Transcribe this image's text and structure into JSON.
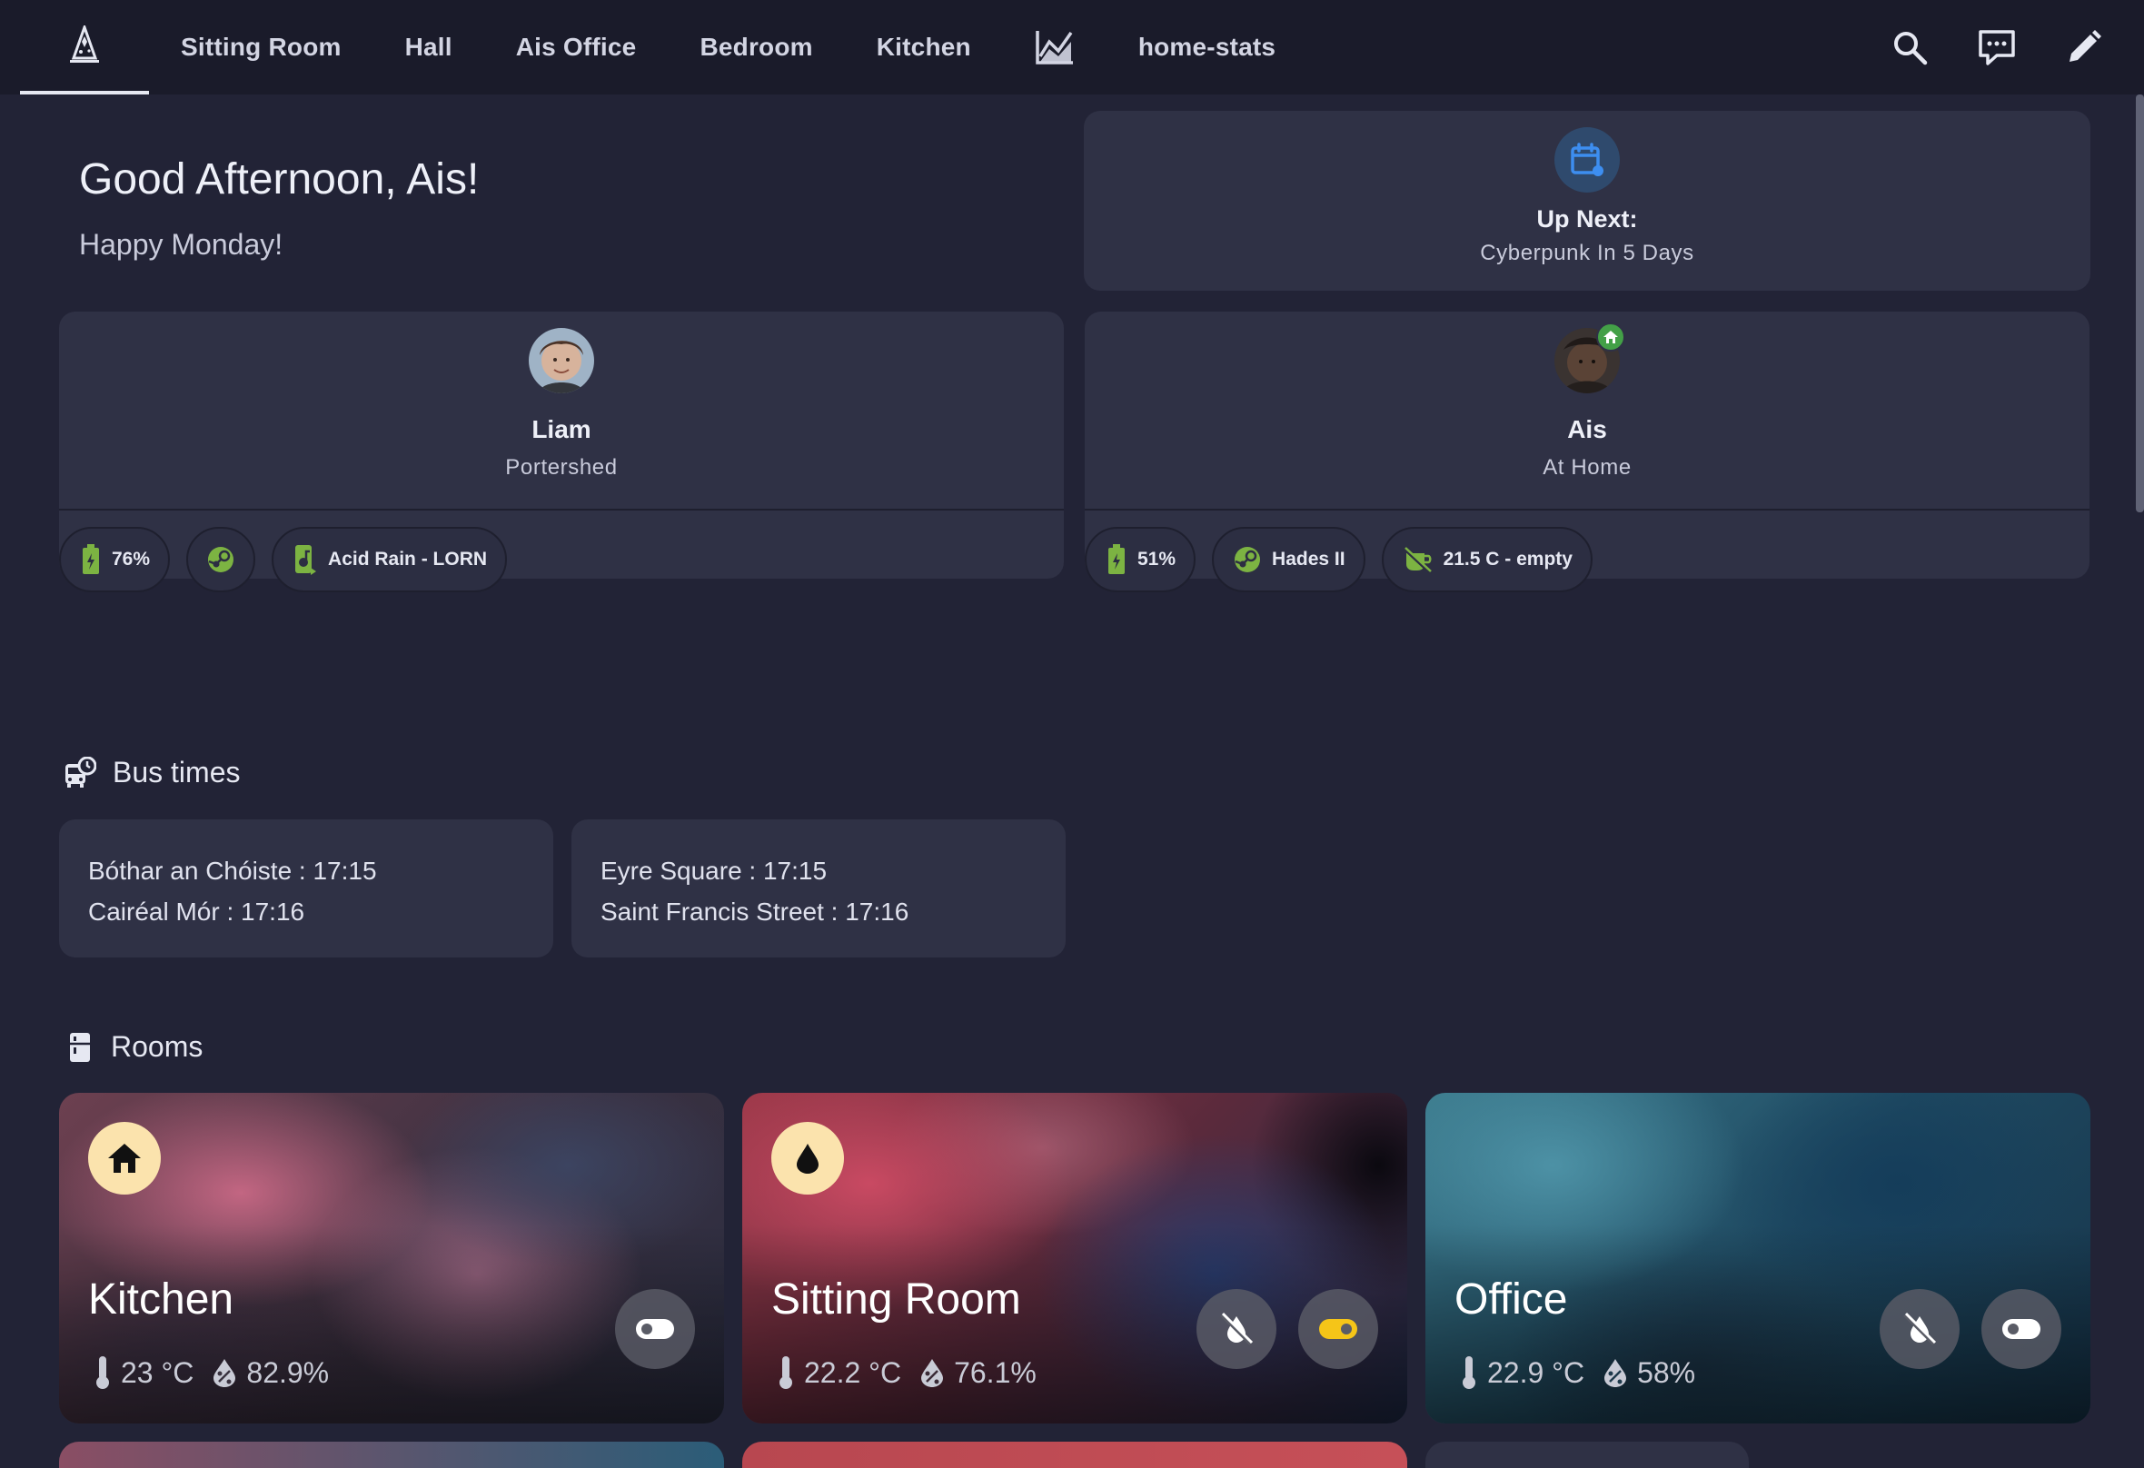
{
  "nav": {
    "tabs": [
      {
        "label": "Sitting Room"
      },
      {
        "label": "Hall"
      },
      {
        "label": "Ais Office"
      },
      {
        "label": "Bedroom"
      },
      {
        "label": "Kitchen"
      },
      {
        "icon": "chart-line-icon"
      },
      {
        "label": "home-stats"
      }
    ],
    "actions": [
      "search-icon",
      "chat-icon",
      "edit-icon"
    ]
  },
  "greeting": {
    "title": "Good Afternoon, Ais!",
    "subtitle": "Happy Monday!"
  },
  "up_next": {
    "icon": "calendar-icon",
    "label": "Up Next:",
    "value": "Cyberpunk In 5 Days"
  },
  "people": [
    {
      "name": "Liam",
      "location": "Portershed",
      "chips": [
        {
          "icon": "battery-charging-icon",
          "text": "76%"
        },
        {
          "icon": "steam-icon",
          "text": ""
        },
        {
          "icon": "music-phone-icon",
          "text": "Acid Rain - LORN"
        }
      ]
    },
    {
      "name": "Ais",
      "location": "At Home",
      "badge": "home-icon",
      "chips": [
        {
          "icon": "battery-charging-icon",
          "text": "51%"
        },
        {
          "icon": "steam-icon",
          "text": "Hades II"
        },
        {
          "icon": "coffee-off-icon",
          "text": "21.5 C - empty"
        }
      ]
    }
  ],
  "bus": {
    "title": "Bus times",
    "cards": [
      {
        "lines": [
          "Bóthar an Chóiste : 17:15",
          "Cairéal Mór : 17:16"
        ]
      },
      {
        "lines": [
          "Eyre Square : 17:15",
          "Saint Francis Street : 17:16"
        ]
      }
    ]
  },
  "rooms": {
    "title": "Rooms",
    "items": [
      {
        "name": "Kitchen",
        "icon": "home-icon",
        "temperature": "23 °C",
        "humidity": "82.9%",
        "controls": [
          "toggle-off"
        ]
      },
      {
        "name": "Sitting Room",
        "icon": "water-drop-icon",
        "temperature": "22.2 °C",
        "humidity": "76.1%",
        "controls": [
          "dehumidifier-off",
          "toggle-on"
        ]
      },
      {
        "name": "Office",
        "icon": "",
        "temperature": "22.9 °C",
        "humidity": "58%",
        "controls": [
          "dehumidifier-off",
          "toggle-off"
        ]
      }
    ]
  },
  "colors": {
    "background": "#222336",
    "card": "#2f3145",
    "topbar": "#1a1b2a",
    "accent_blue": "#3d8ef0",
    "accent_green": "#7cb342",
    "accent_yellow": "#f5c518",
    "room_icon_bg": "#fbe3ad"
  }
}
